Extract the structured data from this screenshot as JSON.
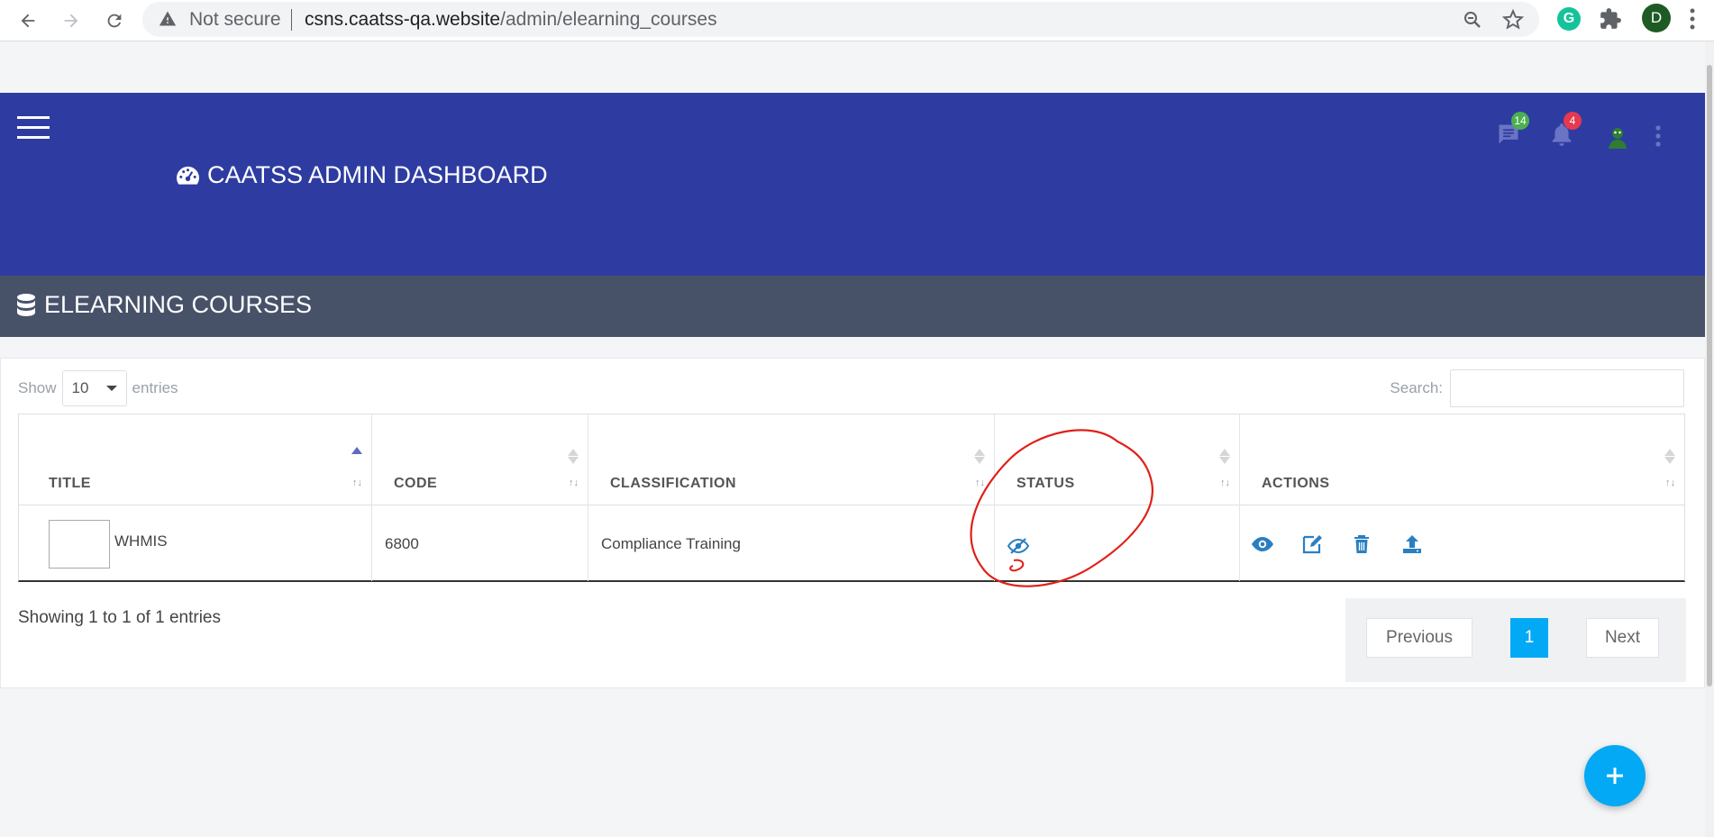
{
  "browser": {
    "security_label": "Not secure",
    "url_host": "csns.caatss-qa.website",
    "url_path": "/admin/elearning_courses",
    "extension_label": "G",
    "profile_initial": "D"
  },
  "header": {
    "title": "CAATSS ADMIN DASHBOARD",
    "messages_count": "14",
    "notifications_count": "4"
  },
  "section": {
    "title": "ELEARNING COURSES"
  },
  "table_controls": {
    "show_label": "Show",
    "entries_value": "10",
    "entries_label": "entries",
    "search_label": "Search:",
    "search_value": ""
  },
  "table": {
    "columns": [
      "TITLE",
      "CODE",
      "CLASSIFICATION",
      "STATUS",
      "ACTIONS"
    ],
    "rows": [
      {
        "title": "WHMIS",
        "code": "6800",
        "classification": "Compliance Training",
        "status_icon": "eye-slash-icon",
        "actions": [
          "view-icon",
          "edit-icon",
          "delete-icon",
          "upload-icon"
        ]
      }
    ]
  },
  "footer": {
    "info": "Showing 1 to 1 of 1 entries",
    "previous": "Previous",
    "current_page": "1",
    "next": "Next"
  },
  "colors": {
    "header_bg": "#2e3ca1",
    "section_bg": "#475269",
    "accent": "#03a9f4",
    "icon_blue": "#2a7fc1"
  }
}
